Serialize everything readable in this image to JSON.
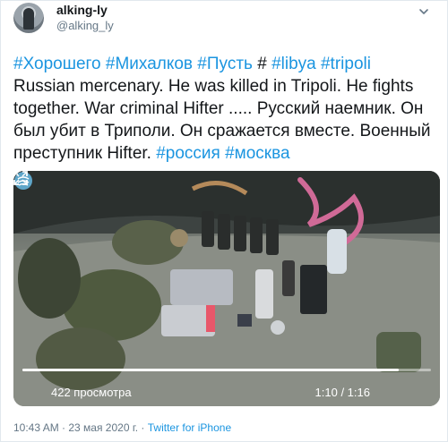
{
  "user": {
    "display_name": "alking-ly",
    "handle": "@alking_ly"
  },
  "tweet": {
    "hashtags_line1": "#Хорошего #Михалков #Пусть",
    "hash_sep": "#",
    "hashtags_line1b": "#libya #tripoli",
    "body_line2": "Russian mercenary.  He was killed in Tripoli.  He fights",
    "body_line3": "together.  War criminal Hifter  ..... Русский наемник.  Он",
    "body_line4": "был убит в Триполи.  Он сражается вместе.  Военный",
    "body_line5": "преступник Hifter.",
    "hashtags_end": "#россия #москва"
  },
  "video": {
    "views": "422 просмотра",
    "time": "1:10 / 1:16",
    "progress": 0.92
  },
  "meta": {
    "timestamp": "10:43 AM · 23 мая 2020 г. · ",
    "source": "Twitter for iPhone"
  },
  "colors": {
    "link": "#1b95e0",
    "text": "#14171a",
    "muted": "#657786"
  },
  "icons": [
    "avatar",
    "caret-down-icon",
    "play-icon",
    "gif-icon",
    "fullscreen-icon"
  ]
}
